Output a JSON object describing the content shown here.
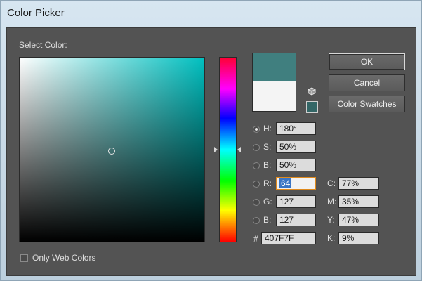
{
  "window": {
    "title": "Color Picker"
  },
  "select_color_label": "Select Color:",
  "colors": {
    "current": "#407F7F",
    "previous": "#F4F4F4",
    "websafe": "#336666"
  },
  "hsb": [
    {
      "key": "h",
      "label": "H:",
      "value": "180°",
      "selected": true
    },
    {
      "key": "s",
      "label": "S:",
      "value": "50%",
      "selected": false
    },
    {
      "key": "b",
      "label": "B:",
      "value": "50%",
      "selected": false
    }
  ],
  "rgb": [
    {
      "key": "r",
      "label": "R:",
      "value": "64",
      "selected": false
    },
    {
      "key": "g",
      "label": "G:",
      "value": "127",
      "selected": false
    },
    {
      "key": "b",
      "label": "B:",
      "value": "127",
      "selected": false
    }
  ],
  "hex": {
    "label": "#",
    "value": "407F7F"
  },
  "cmyk": [
    {
      "key": "c",
      "label": "C:",
      "value": "77%"
    },
    {
      "key": "m",
      "label": "M:",
      "value": "35%"
    },
    {
      "key": "y",
      "label": "Y:",
      "value": "47%"
    },
    {
      "key": "k",
      "label": "K:",
      "value": "9%"
    }
  ],
  "buttons": {
    "ok": "OK",
    "cancel": "Cancel",
    "swatches": "Color Swatches"
  },
  "only_web_colors": {
    "label": "Only Web Colors",
    "checked": false
  },
  "icons": {
    "websafe": "cube-icon",
    "marker": "color-marker-circle"
  }
}
